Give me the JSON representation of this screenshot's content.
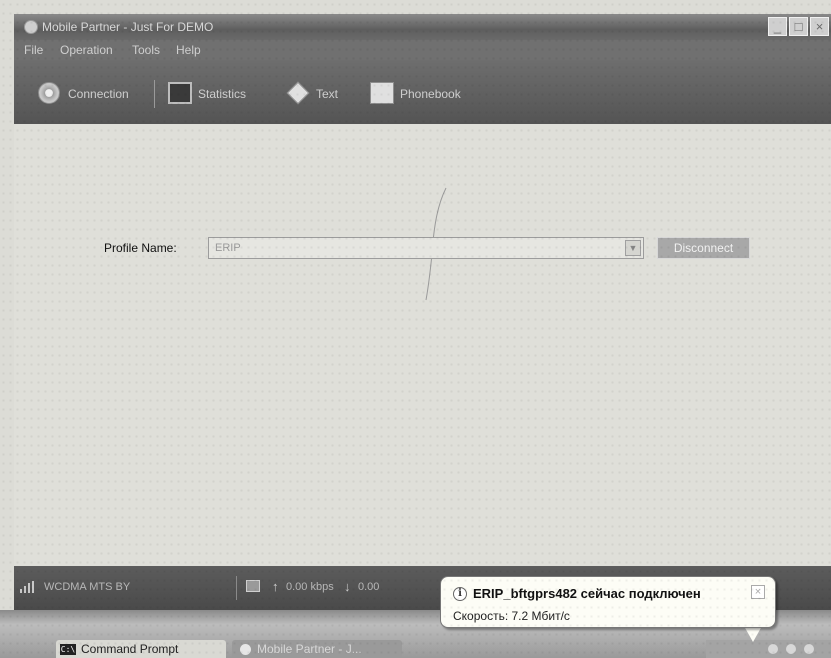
{
  "window": {
    "title": "Mobile Partner - Just For DEMO",
    "controls": {
      "minimize": "_",
      "maximize": "□",
      "close": "×"
    }
  },
  "menu": [
    "File",
    "Operation",
    "Tools",
    "Help"
  ],
  "toolbar": {
    "connection": "Connection",
    "statistics": "Statistics",
    "text": "Text",
    "phonebook": "Phonebook"
  },
  "main": {
    "profile_label": "Profile Name:",
    "profile_value": "ERIP",
    "disconnect_label": "Disconnect"
  },
  "status": {
    "network": "WCDMA MTS BY",
    "upload_speed": "0.00 kbps",
    "download_speed": "0.00"
  },
  "taskbar": {
    "command_prompt": "Command Prompt",
    "mobile_partner": "Mobile Partner - J..."
  },
  "notification": {
    "title": "ERIP_bftgprs482 сейчас подключен",
    "message": "Скорость: 7.2 Мбит/с"
  }
}
